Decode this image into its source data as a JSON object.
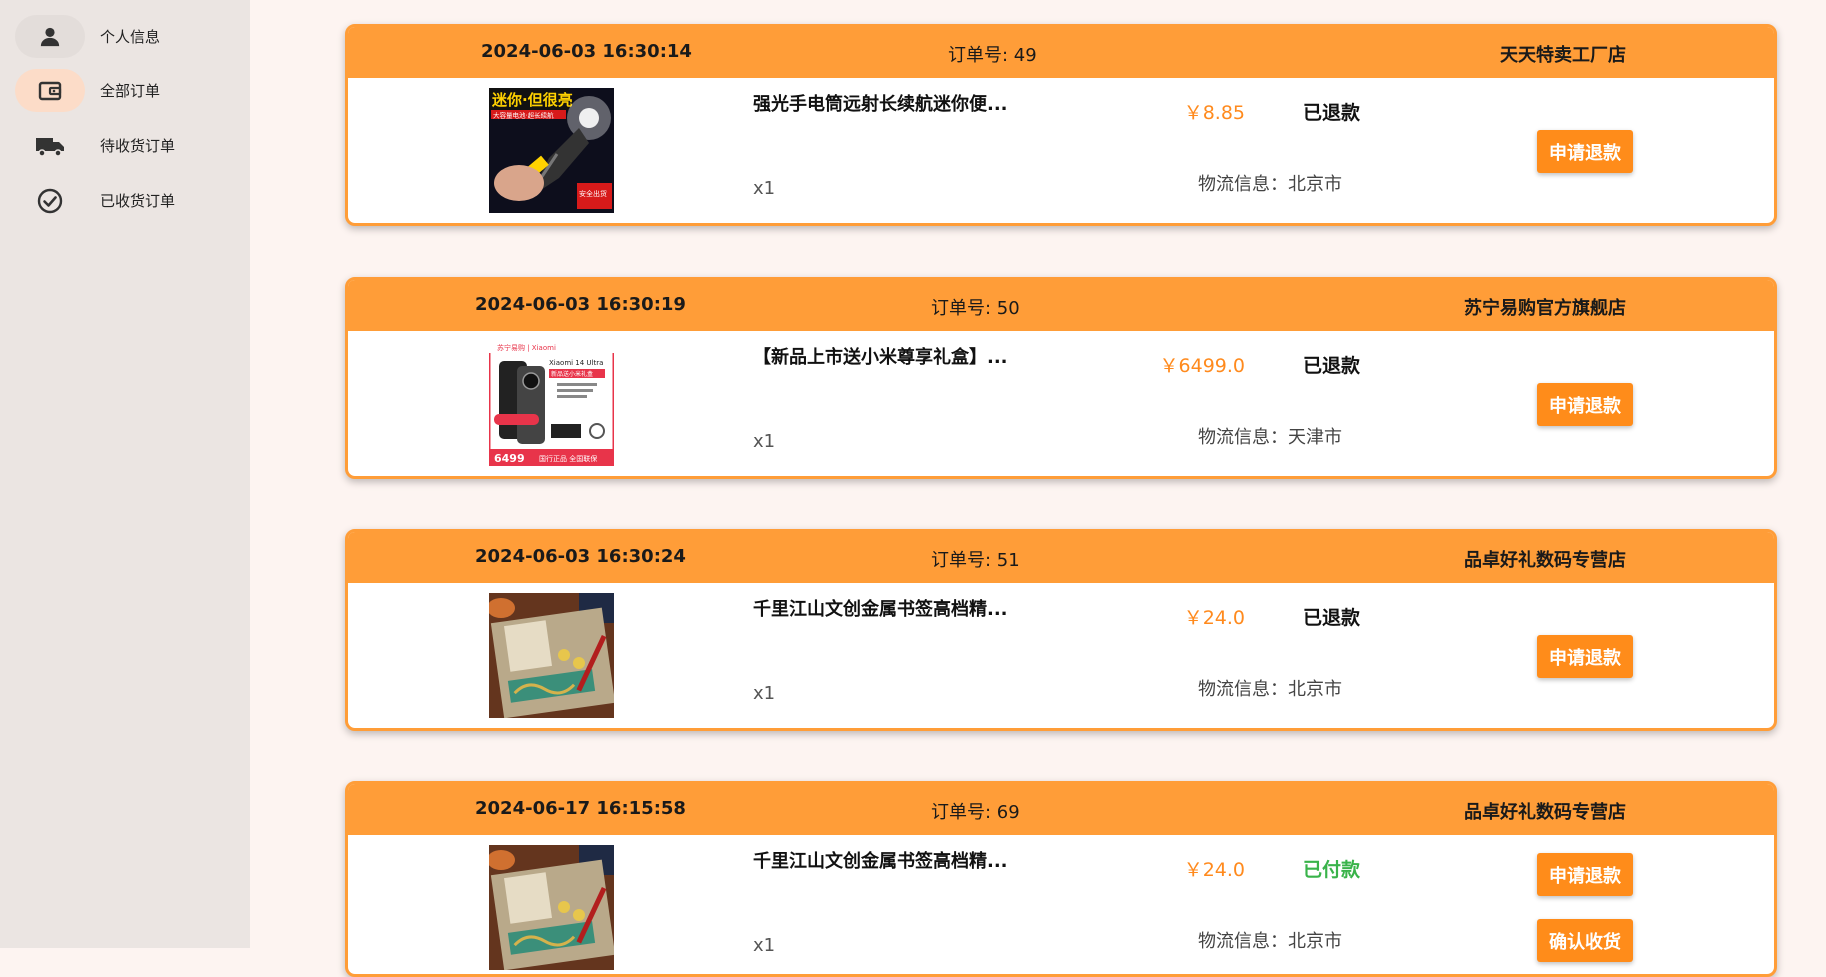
{
  "sidebar": {
    "items": [
      {
        "label": "个人信息",
        "icon": "person-icon"
      },
      {
        "label": "全部订单",
        "icon": "wallet-icon"
      },
      {
        "label": "待收货订单",
        "icon": "truck-icon"
      },
      {
        "label": "已收货订单",
        "icon": "check-circle-icon"
      }
    ],
    "active_index": 1
  },
  "colors": {
    "accent": "#ff9d38",
    "button": "#ff8c1a",
    "price": "#ff8a1d",
    "paid": "#39b34a",
    "sidebar_bg": "#ebe5e2",
    "page_bg": "#fdf4f1"
  },
  "orders": [
    {
      "date": "2024-06-03 16:30:14",
      "order_no": "订单号: 49",
      "shop": "天天特卖工厂店",
      "product_name": "强光手电筒远射长续航迷你便...",
      "quantity": "x1",
      "price": "￥8.85",
      "status": "已退款",
      "logistics": "物流信息：北京市",
      "buttons": [
        "申请退款"
      ],
      "image": {
        "kind": "flashlight",
        "banner": "迷你·但很亮",
        "sub": "大容量电池·超长续航",
        "badge": "安全出货"
      }
    },
    {
      "date": "2024-06-03 16:30:19",
      "order_no": "订单号: 50",
      "shop": "苏宁易购官方旗舰店",
      "product_name": "【新品上市送小米尊享礼盒】...",
      "quantity": "x1",
      "price": "￥6499.0",
      "status": "已退款",
      "logistics": "物流信息：天津市",
      "buttons": [
        "申请退款"
      ],
      "image": {
        "kind": "phone",
        "banner": "苏宁易购 | Xiaomi",
        "model": "Xiaomi 14 Ultra",
        "gift": "新品送小米礼盒",
        "price_tag": "6499",
        "footer": "国行正品 全国联保"
      }
    },
    {
      "date": "2024-06-03 16:30:24",
      "order_no": "订单号: 51",
      "shop": "品卓好礼数码专营店",
      "product_name": "千里江山文创金属书签高档精...",
      "quantity": "x1",
      "price": "￥24.0",
      "status": "已退款",
      "logistics": "物流信息：北京市",
      "buttons": [
        "申请退款"
      ],
      "image": {
        "kind": "bookmark"
      }
    },
    {
      "date": "2024-06-17 16:15:58",
      "order_no": "订单号: 69",
      "shop": "品卓好礼数码专营店",
      "product_name": "千里江山文创金属书签高档精...",
      "quantity": "x1",
      "price": "￥24.0",
      "status": "已付款",
      "logistics": "物流信息：北京市",
      "buttons": [
        "申请退款",
        "确认收货"
      ],
      "image": {
        "kind": "bookmark"
      }
    }
  ]
}
